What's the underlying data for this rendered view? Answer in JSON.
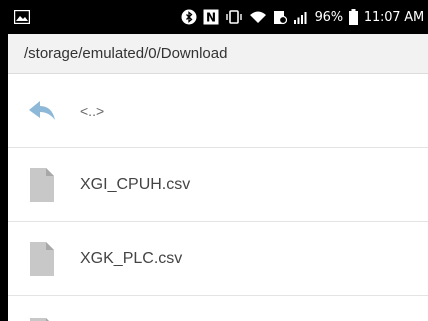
{
  "status_bar": {
    "battery_percent": "96%",
    "time": "11:07 AM",
    "icons": [
      "picture-icon",
      "bluetooth-icon",
      "nfc-icon",
      "vibrate-icon",
      "wifi-icon",
      "data-saver-icon",
      "signal-icon",
      "battery-icon"
    ]
  },
  "path_bar": {
    "path": "/storage/emulated/0/Download"
  },
  "files": {
    "items": [
      {
        "label": "<..>",
        "icon": "back-arrow-icon",
        "type": "parent"
      },
      {
        "label": "XGI_CPUH.csv",
        "icon": "file-icon",
        "type": "file"
      },
      {
        "label": "XGK_PLC.csv",
        "icon": "file-icon",
        "type": "file"
      }
    ]
  },
  "colors": {
    "status_bg": "#000000",
    "path_bg": "#f2f2f2",
    "back_arrow": "#8db8d8",
    "file_icon": "#c8c8c8",
    "file_icon_fold": "#a8a8a8"
  }
}
